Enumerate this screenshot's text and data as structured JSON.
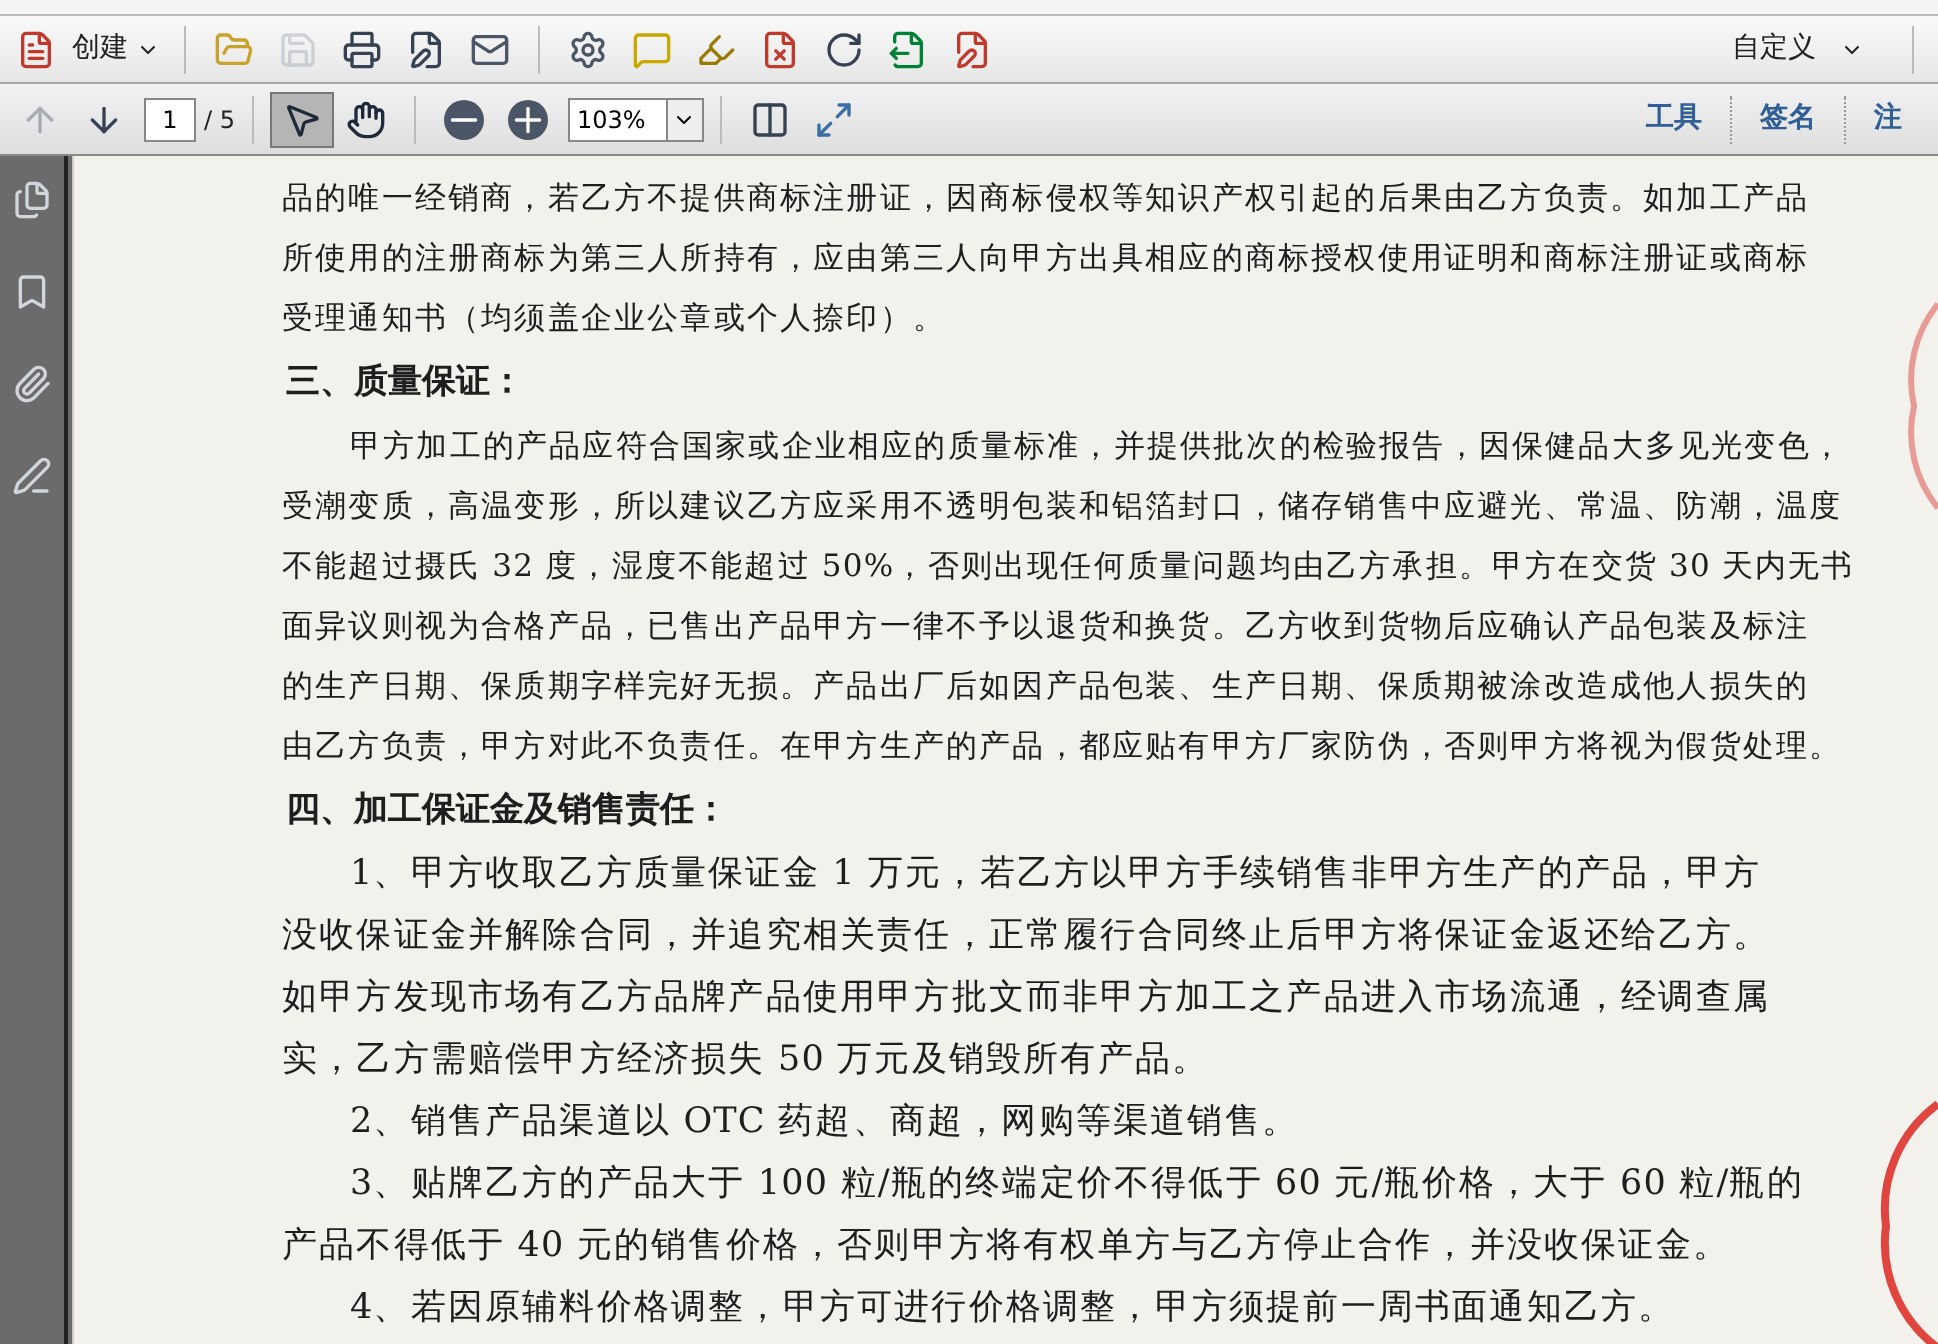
{
  "toolbar": {
    "create_label": "创建",
    "tools": [
      {
        "kind": "open",
        "disabled": false
      },
      {
        "kind": "save",
        "disabled": true
      },
      {
        "kind": "print",
        "disabled": false
      },
      {
        "kind": "edit",
        "disabled": false
      },
      {
        "kind": "email",
        "disabled": false
      }
    ],
    "review_tools": [
      {
        "kind": "settings"
      },
      {
        "kind": "comment"
      },
      {
        "kind": "highlight"
      },
      {
        "kind": "delete"
      },
      {
        "kind": "rotate"
      },
      {
        "kind": "export"
      },
      {
        "kind": "sign"
      }
    ],
    "customize_label": "自定义"
  },
  "nav_bar": {
    "prev_disabled": true,
    "next_disabled": false,
    "page": "1",
    "page_total": "/ 5",
    "modes": [
      {
        "kind": "select",
        "selected": true
      },
      {
        "kind": "hand",
        "selected": false
      }
    ],
    "zoom": "103%",
    "panes": [
      "工具",
      "签名",
      "注"
    ]
  },
  "sidebar": {
    "items": [
      {
        "kind": "pages"
      },
      {
        "kind": "bookmarks"
      },
      {
        "kind": "attachments"
      },
      {
        "kind": "signatures"
      }
    ]
  },
  "document": {
    "blocks": [
      {
        "kind": "body",
        "indent": false,
        "lines": [
          "品的唯一经销商，若乙方不提供商标注册证，因商标侵权等知识产权引起的后果由乙方负责。如加工产品",
          "所使用的注册商标为第三人所持有，应由第三人向甲方出具相应的商标授权使用证明和商标注册证或商标",
          "受理通知书（均须盖企业公章或个人捺印）。"
        ]
      },
      {
        "kind": "heading",
        "lines": [
          "三、质量保证："
        ]
      },
      {
        "kind": "body",
        "indent": true,
        "lines": [
          "甲方加工的产品应符合国家或企业相应的质量标准，并提供批次的检验报告，因保健品大多见光变色，",
          "受潮变质，高温变形，所以建议乙方应采用不透明包装和铝箔封口，储存销售中应避光、常温、防潮，温度",
          "不能超过摄氏 32 度，湿度不能超过 50%，否则出现任何质量问题均由乙方承担。甲方在交货 30 天内无书",
          "面异议则视为合格产品，已售出产品甲方一律不予以退货和换货。乙方收到货物后应确认产品包装及标注",
          "的生产日期、保质期字样完好无损。产品出厂后如因产品包装、生产日期、保质期被涂改造成他人损失的",
          "由乙方负责，甲方对此不负责任。在甲方生产的产品，都应贴有甲方厂家防伪，否则甲方将视为假货处理。"
        ]
      },
      {
        "kind": "heading",
        "lines": [
          "四、加工保证金及销售责任："
        ]
      },
      {
        "kind": "large",
        "indent": true,
        "lines": [
          "1、甲方收取乙方质量保证金 1 万元，若乙方以甲方手续销售非甲方生产的产品，甲方",
          "没收保证金并解除合同，并追究相关责任，正常履行合同终止后甲方将保证金返还给乙方。",
          "如甲方发现市场有乙方品牌产品使用甲方批文而非甲方加工之产品进入市场流通，经调查属",
          "实，乙方需赔偿甲方经济损失 50 万元及销毁所有产品。"
        ]
      },
      {
        "kind": "large",
        "indent": true,
        "lines": [
          "2、销售产品渠道以 OTC 药超、商超，网购等渠道销售。"
        ]
      },
      {
        "kind": "large",
        "indent": true,
        "lines": [
          "3、贴牌乙方的产品大于 100 粒/瓶的终端定价不得低于 60 元/瓶价格，大于 60 粒/瓶的",
          "产品不得低于 40 元的销售价格，否则甲方将有权单方与乙方停止合作，并没收保证金。"
        ]
      },
      {
        "kind": "large",
        "indent": true,
        "lines": [
          "4、若因原辅料价格调整，甲方可进行价格调整，甲方须提前一周书面通知乙方。"
        ]
      }
    ]
  }
}
